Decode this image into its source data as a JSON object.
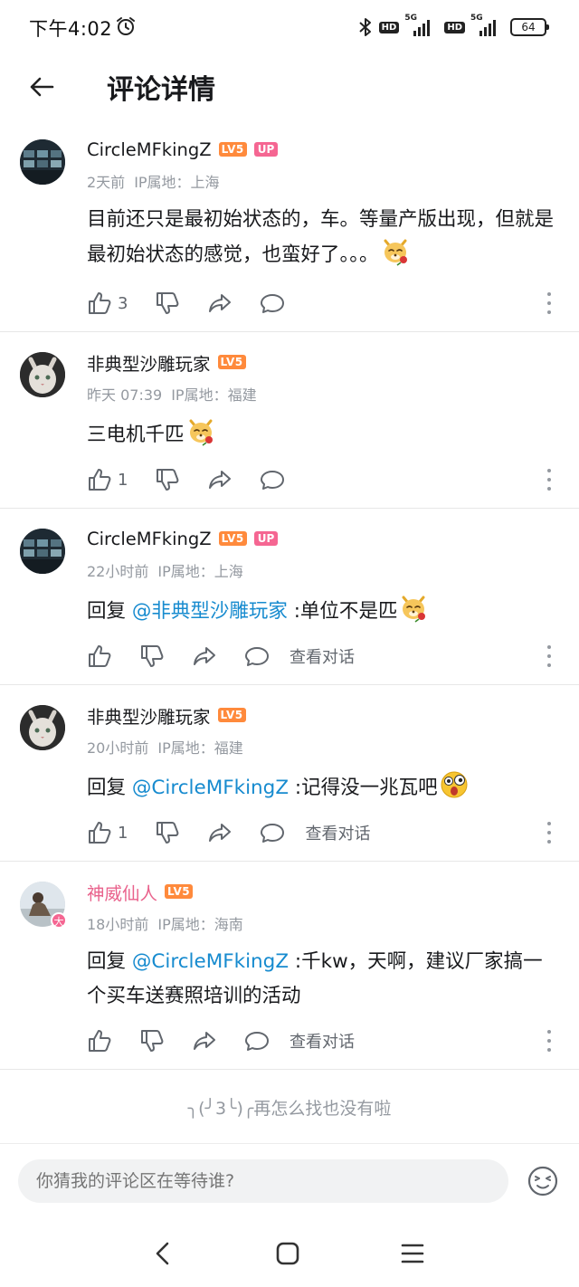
{
  "status_bar": {
    "time": "下午4:02",
    "sim1_type": "5G",
    "sim2_type": "5G",
    "hd1": "HD",
    "hd2": "HD",
    "battery": "64"
  },
  "header": {
    "title": "评论详情"
  },
  "comments": [
    {
      "username": "CircleMFkingZ",
      "level": "LV5",
      "up_badge": "UP",
      "time": "2天前",
      "ip": "IP属地：上海",
      "text": "目前还只是最初始状态的，车。等量产版出现，但就是最初始状态的感觉，也蛮好了。。。",
      "emoji": "doge-rose",
      "likes": "3"
    },
    {
      "username": "非典型沙雕玩家",
      "level": "LV5",
      "time": "昨天 07:39",
      "ip": "IP属地：福建",
      "text": "三电机千匹",
      "emoji": "doge-rose",
      "likes": "1"
    },
    {
      "username": "CircleMFkingZ",
      "level": "LV5",
      "up_badge": "UP",
      "time": "22小时前",
      "ip": "IP属地：上海",
      "reply_prefix": "回复 ",
      "mention": "@非典型沙雕玩家",
      "text": " :单位不是匹",
      "emoji": "doge-rose",
      "view_conversation": "查看对话"
    },
    {
      "username": "非典型沙雕玩家",
      "level": "LV5",
      "time": "20小时前",
      "ip": "IP属地：福建",
      "reply_prefix": "回复 ",
      "mention": "@CircleMFkingZ",
      "text": " :记得没一兆瓦吧",
      "emoji": "shocked-face",
      "likes": "1",
      "view_conversation": "查看对话"
    },
    {
      "username": "神威仙人",
      "level": "LV5",
      "avatar_badge": "大",
      "time": "18小时前",
      "ip": "IP属地：海南",
      "reply_prefix": "回复 ",
      "mention": "@CircleMFkingZ",
      "text": " :千kw，天啊，建议厂家搞一个买车送赛照培训的活动",
      "view_conversation": "查看对话"
    }
  ],
  "end_text": "╮(╯3╰)╭再怎么找也没有啦",
  "input": {
    "placeholder": "你猜我的评论区在等待谁?"
  },
  "colors": {
    "mention": "#178bcf",
    "level_badge": "#ff8a3c",
    "up_badge": "#f56692",
    "vip_name": "#e9628c"
  }
}
